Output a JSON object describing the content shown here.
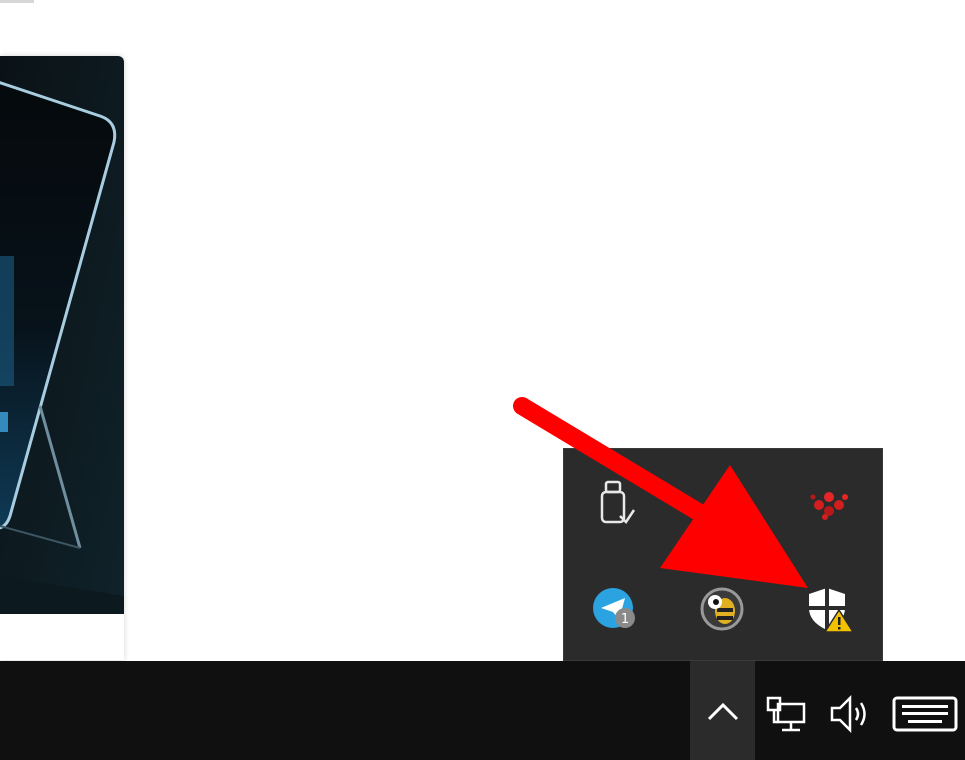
{
  "window": {
    "description_free": true
  },
  "thumbnail": {
    "icon": "device-photo",
    "colors": {
      "background": "#0b1418",
      "device_edge": "#9fc3d6"
    }
  },
  "tray_flyout": {
    "icons": [
      {
        "name": "usb-eject-icon"
      },
      {
        "name": "paint-icon"
      },
      {
        "name": "red-dots-app-icon"
      },
      {
        "name": "telegram-icon",
        "badge": "1"
      },
      {
        "name": "bee-app-icon"
      },
      {
        "name": "windows-security-warning-icon"
      }
    ],
    "background": "#2b2b2b"
  },
  "taskbar": {
    "background": "#101010",
    "chevron_icon": "chevron-up-icon",
    "system_icons": [
      "network-icon",
      "volume-icon",
      "touch-keyboard-icon"
    ]
  },
  "annotation": {
    "color": "#ff0000",
    "icon": "red-arrow"
  }
}
